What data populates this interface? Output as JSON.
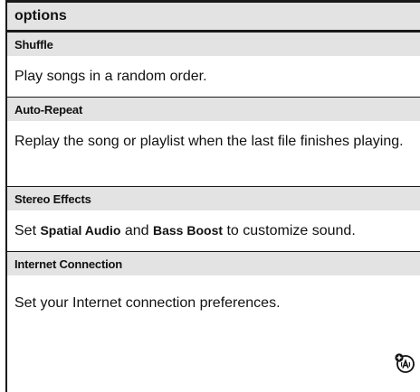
{
  "header": {
    "title": "options"
  },
  "rows": [
    {
      "term": "Shuffle",
      "desc": "Play songs in a random order."
    },
    {
      "term": "Auto-Repeat",
      "desc": "Replay the song or playlist when the last file finishes playing."
    },
    {
      "term": "Stereo Effects",
      "desc_parts": [
        "Set ",
        "Spatial Audio",
        " and ",
        "Bass Boost",
        " to customize sound."
      ]
    },
    {
      "term": "Internet Connection",
      "desc": "Set your Internet connection preferences."
    }
  ],
  "icons": {
    "badge": "network-feature-icon"
  }
}
